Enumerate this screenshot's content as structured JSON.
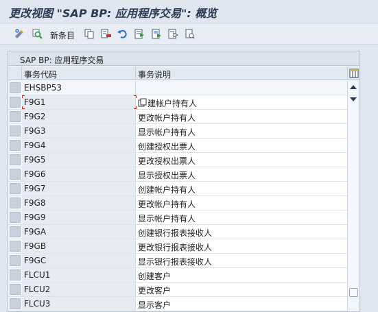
{
  "title": "更改视图 \"SAP BP: 应用程序交易\": 概览",
  "toolbar": {
    "new_entries_label": "新条目",
    "icons": [
      "display-change-icon",
      "where-used-icon",
      "copy-icon",
      "delete-icon",
      "undo-icon",
      "select-all-icon",
      "select-block-icon",
      "deselect-all-icon",
      "print-icon"
    ]
  },
  "panel": {
    "title": "SAP BP: 应用程序交易",
    "columns": {
      "code": "事务代码",
      "description": "事务说明"
    }
  },
  "rows": [
    {
      "code": "EHSBP53",
      "description": ""
    },
    {
      "code": "F9G1",
      "description": "建帐户持有人"
    },
    {
      "code": "F9G2",
      "description": "更改帐户持有人"
    },
    {
      "code": "F9G3",
      "description": "显示帐户持有人"
    },
    {
      "code": "F9G4",
      "description": "创建授权出票人"
    },
    {
      "code": "F9G5",
      "description": "更改授权出票人"
    },
    {
      "code": "F9G6",
      "description": "显示授权出票人"
    },
    {
      "code": "F9G7",
      "description": "创建帐户持有人"
    },
    {
      "code": "F9G8",
      "description": "更改帐户持有人"
    },
    {
      "code": "F9G9",
      "description": "显示帐户持有人"
    },
    {
      "code": "F9GA",
      "description": "创建银行报表接收人"
    },
    {
      "code": "F9GB",
      "description": "更改银行报表接收人"
    },
    {
      "code": "F9GC",
      "description": "显示银行报表接收人"
    },
    {
      "code": "FLCU1",
      "description": "创建客户"
    },
    {
      "code": "FLCU2",
      "description": "更改客户"
    },
    {
      "code": "FLCU3",
      "description": "显示客户"
    }
  ],
  "colors": {
    "background": "#dfe6ef",
    "title": "#2a3b55",
    "focus": "#d02020"
  }
}
